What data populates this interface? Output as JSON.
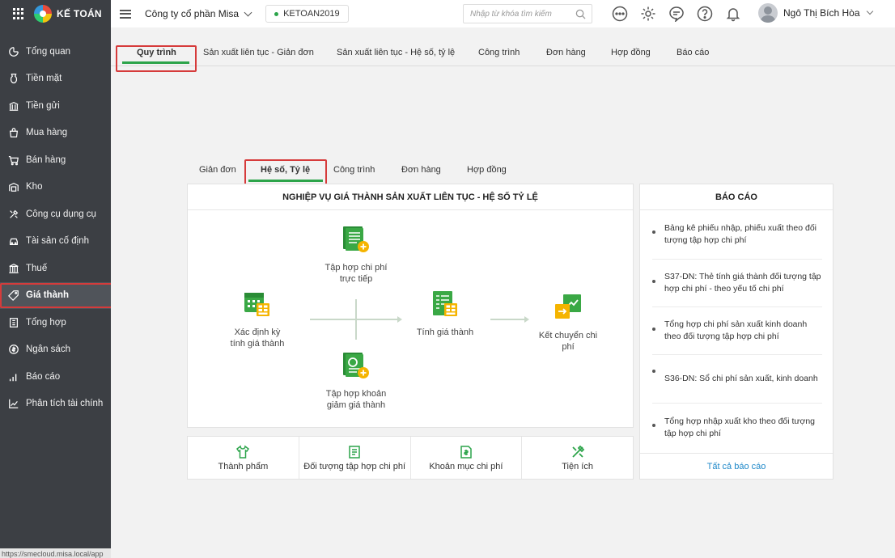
{
  "app": {
    "name": "KẾ TOÁN"
  },
  "sidebar": {
    "items": [
      {
        "label": "Tổng quan",
        "icon": "dashboard-icon"
      },
      {
        "label": "Tiền mặt",
        "icon": "cash-icon"
      },
      {
        "label": "Tiền gửi",
        "icon": "bank-icon"
      },
      {
        "label": "Mua hàng",
        "icon": "shopping-bag-icon"
      },
      {
        "label": "Bán hàng",
        "icon": "cart-icon"
      },
      {
        "label": "Kho",
        "icon": "warehouse-icon"
      },
      {
        "label": "Công cụ dụng cụ",
        "icon": "tools-icon"
      },
      {
        "label": "Tài sản cố định",
        "icon": "car-icon"
      },
      {
        "label": "Thuế",
        "icon": "tax-building-icon"
      },
      {
        "label": "Giá thành",
        "icon": "price-tag-icon",
        "active": true
      },
      {
        "label": "Tổng hợp",
        "icon": "ledger-icon"
      },
      {
        "label": "Ngân sách",
        "icon": "budget-icon"
      },
      {
        "label": "Báo cáo",
        "icon": "bar-chart-icon"
      },
      {
        "label": "Phân tích tài chính",
        "icon": "line-chart-icon"
      }
    ],
    "status_url": "https://smecloud.misa.local/app"
  },
  "topbar": {
    "company": "Công ty cổ phần Misa",
    "database": "KETOAN2019",
    "search_placeholder": "Nhập từ khóa tìm kiếm",
    "user_name": "Ngô Thị Bích Hòa"
  },
  "main_tabs": [
    "Quy trình",
    "Sản xuất liên tục - Giản đơn",
    "Sản xuất liên tục - Hệ số, tỷ lệ",
    "Công trình",
    "Đơn hàng",
    "Hợp đồng",
    "Báo cáo"
  ],
  "sub_tabs": [
    "Giản đơn",
    "Hệ số, Tỷ lệ",
    "Công trình",
    "Đơn hàng",
    "Hợp đồng"
  ],
  "flow": {
    "title": "NGHIỆP VỤ GIÁ THÀNH SẢN XUẤT LIÊN TỤC - HỆ SỐ TỶ LỆ",
    "nodes": {
      "period": [
        "Xác định kỳ",
        "tính giá thành"
      ],
      "collect_direct": [
        "Tập hợp chi phí",
        "trực tiếp"
      ],
      "collect_reduce": [
        "Tập hợp khoản",
        "giảm giá thành"
      ],
      "calculate": [
        "Tính giá thành"
      ],
      "transfer": [
        "Kết chuyển chi",
        "phí"
      ]
    }
  },
  "bottom_actions": [
    "Thành phẩm",
    "Đối tượng tập hợp chi phí",
    "Khoản mục chi phí",
    "Tiện ích"
  ],
  "reports": {
    "title": "BÁO CÁO",
    "items": [
      "Bảng kê phiếu nhập, phiếu xuất theo đối tượng tập hợp chi phí",
      "S37-DN: Thẻ tính giá thành đối tượng tập hợp chi phí - theo yếu tố chi phí",
      "Tổng hợp chi phí sản xuất kinh doanh theo đối tượng tập hợp chi phí",
      "S36-DN: Sổ chi phí sản xuất, kinh doanh",
      "Tổng hợp nhập xuất kho theo đối tượng tập hợp chi phí"
    ],
    "all_link": "Tất cả báo cáo"
  },
  "colors": {
    "accent": "#2ca44a",
    "highlight_box": "#d63b3b",
    "sidebar_bg": "#3c3f44",
    "link": "#1e88c9"
  }
}
